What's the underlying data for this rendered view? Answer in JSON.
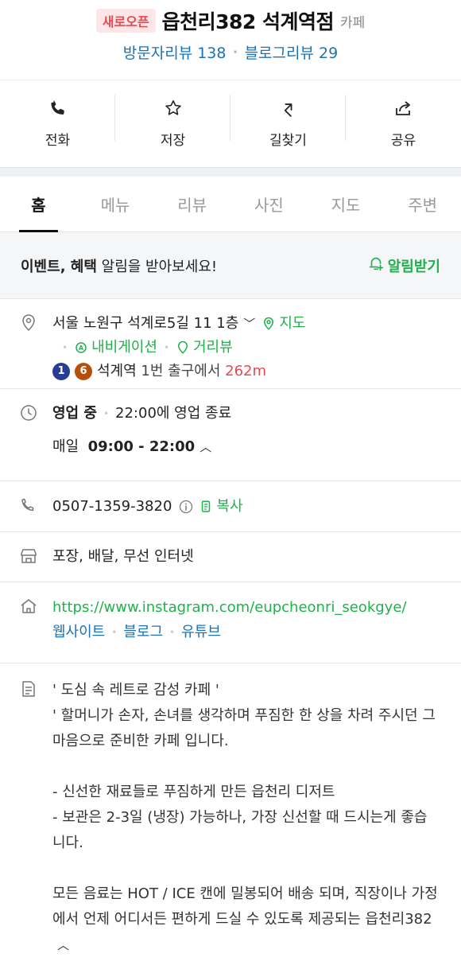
{
  "header": {
    "badge": "새로오픈",
    "name": "읍천리382 석계역점",
    "category": "카페",
    "visitor_reviews": "방문자리뷰 138",
    "blog_reviews": "블로그리뷰 29"
  },
  "actions": [
    {
      "label": "전화",
      "icon": "phone-icon"
    },
    {
      "label": "저장",
      "icon": "star-icon"
    },
    {
      "label": "길찾기",
      "icon": "directions-icon"
    },
    {
      "label": "공유",
      "icon": "share-icon"
    }
  ],
  "tabs": [
    {
      "label": "홈",
      "active": true
    },
    {
      "label": "메뉴"
    },
    {
      "label": "리뷰"
    },
    {
      "label": "사진"
    },
    {
      "label": "지도"
    },
    {
      "label": "주변"
    }
  ],
  "event": {
    "bold1": "이벤트",
    "comma": ", ",
    "bold2": "혜택",
    "rest": " 알림을 받아보세요!",
    "button": "알림받기"
  },
  "address": {
    "text": "서울 노원구 석계로5길 11 1층",
    "map_link": "지도",
    "navigation": "내비게이션",
    "street_view": "거리뷰",
    "subway_lines": [
      "1",
      "6"
    ],
    "station": "석계역",
    "exit": "1번 출구에서",
    "distance": "262m"
  },
  "hours": {
    "status": "영업 중",
    "close_info": "22:00에 영업 종료",
    "day": "매일",
    "time": "09:00 - 22:00"
  },
  "phone": {
    "number": "0507-1359-3820",
    "copy": "복사"
  },
  "amenities": "포장, 배달, 무선 인터넷",
  "website": {
    "url": "https://www.instagram.com/eupcheonri_seokgye/",
    "links": [
      "웹사이트",
      "블로그",
      "유튜브"
    ]
  },
  "description": {
    "text": "' 도심 속 레트로 감성 카페 '\n' 할머니가 손자, 손녀를 생각하며 푸짐한 한 상을 차려 주시던 그 마음으로 준비한 카페 입니다.\n\n- 신선한 재료들로 푸짐하게 만든 읍천리 디저트\n- 보관은 2-3일 (냉장) 가능하나, 가장 신선할 때 드시는게 좋습니다.\n\n모든 음료는 HOT / ICE 캔에 밀봉되어 배송 되며, 직장이나 가정에서 언제 어디서든 편하게 드실 수 있도록 제공되는 읍천리382"
  },
  "colors": {
    "green": "#1fb14b",
    "blue": "#1a73b7",
    "red": "#e8494f"
  }
}
